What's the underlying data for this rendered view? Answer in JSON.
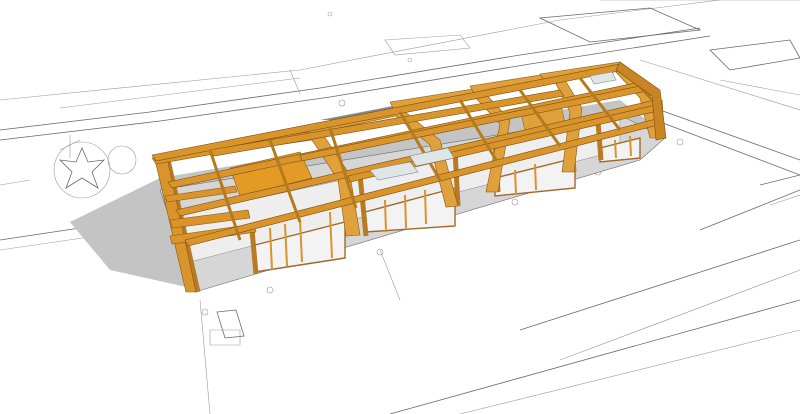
{
  "viewport": {
    "background": "#ffffff",
    "model_colors": {
      "timber": "#d9942c",
      "timber_dark": "#a86a14",
      "timber_light": "#f0b34a",
      "shadow": "#bdbdbd",
      "glass": "#e8eef0",
      "linework": "#6a6a6a"
    },
    "model_description_icon": "timber-frame-building-3d-model",
    "site_elements": [
      "site-plan-linework",
      "tree-symbol",
      "ground-shadow",
      "road-edges",
      "parking-outline"
    ]
  }
}
